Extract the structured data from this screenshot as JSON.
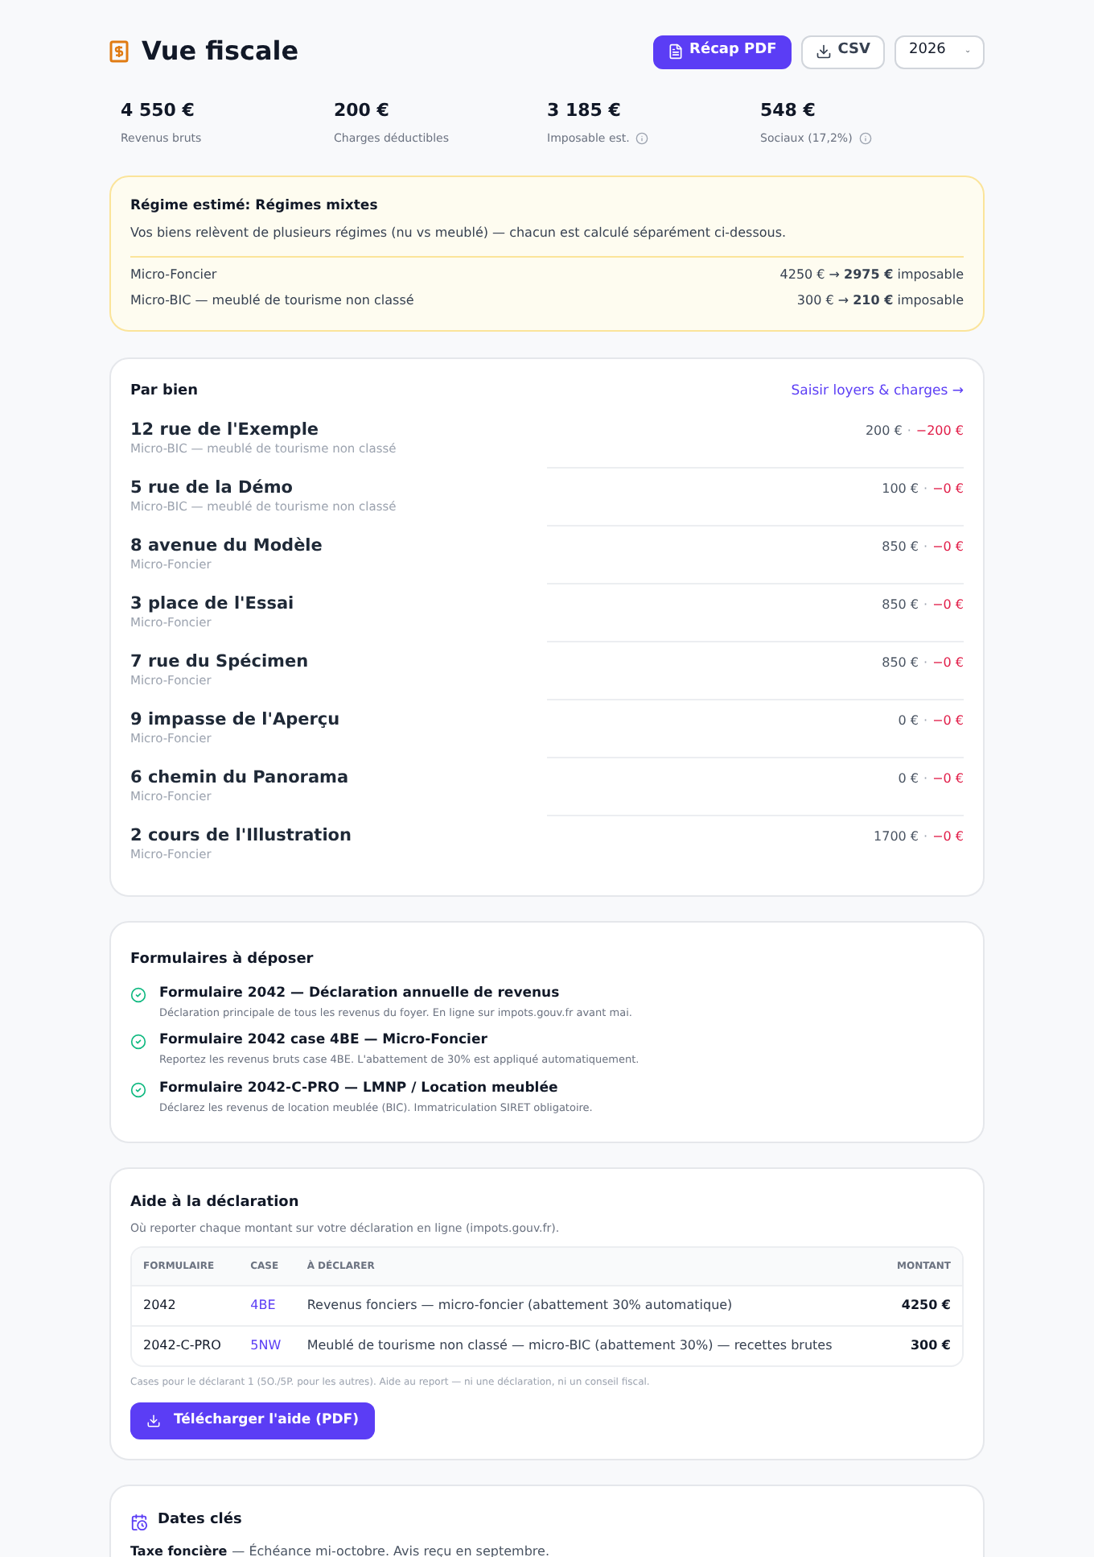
{
  "header": {
    "title": "Vue fiscale",
    "buttons": [
      {
        "label": "Récap PDF",
        "kind": "primary"
      },
      {
        "label": "CSV",
        "kind": "secondary"
      }
    ],
    "year": "2026"
  },
  "stats": [
    {
      "value": "4 550 €",
      "label": "Revenus bruts",
      "info": false
    },
    {
      "value": "200 €",
      "label": "Charges déductibles",
      "info": false
    },
    {
      "value": "3 185 €",
      "label": "Imposable est.",
      "info": true
    },
    {
      "value": "548 €",
      "label": "Sociaux (17,2%)",
      "info": true
    }
  ],
  "regime": {
    "title": "Régime estimé: Régimes mixtes",
    "description": "Vos biens relèvent de plusieurs régimes (nu vs meublé) — chacun est calculé séparément ci-dessous.",
    "lines": [
      {
        "name": "Micro-Foncier",
        "value": "4250 € → **2975 €** imposable"
      },
      {
        "name": "Micro-BIC — meublé de tourisme non classé",
        "value": "300 € → **210 €** imposable"
      }
    ]
  },
  "par_bien": {
    "title": "Par bien",
    "link": "Saisir loyers & charges →",
    "items": [
      {
        "address": "12 rue de l'Exemple",
        "regime": "Micro-BIC — meublé de tourisme non classé",
        "amount": "200 €",
        "separator": "·",
        "deduction": "−200 €"
      },
      {
        "address": "5 rue de la Démo",
        "regime": "Micro-BIC — meublé de tourisme non classé",
        "amount": "100 €",
        "separator": "·",
        "deduction": "−0 €"
      },
      {
        "address": "8 avenue du Modèle",
        "regime": "Micro-Foncier",
        "amount": "850 €",
        "separator": "·",
        "deduction": "−0 €"
      },
      {
        "address": "3 place de l'Essai",
        "regime": "Micro-Foncier",
        "amount": "850 €",
        "separator": "·",
        "deduction": "−0 €"
      },
      {
        "address": "7 rue du Spécimen",
        "regime": "Micro-Foncier",
        "amount": "850 €",
        "separator": "·",
        "deduction": "−0 €"
      },
      {
        "address": "9 impasse de l'Aperçu",
        "regime": "Micro-Foncier",
        "amount": "0 €",
        "separator": "·",
        "deduction": "−0 €"
      },
      {
        "address": "6 chemin du Panorama",
        "regime": "Micro-Foncier",
        "amount": "0 €",
        "separator": "·",
        "deduction": "−0 €"
      },
      {
        "address": "2 cours de l'Illustration",
        "regime": "Micro-Foncier",
        "amount": "1700 €",
        "separator": "·",
        "deduction": "−0 €"
      }
    ]
  },
  "formulaires": {
    "title": "Formulaires à déposer",
    "items": [
      {
        "title": "Formulaire 2042 — Déclaration annuelle de revenus",
        "description": "Déclaration principale de tous les revenus du foyer. En ligne sur impots.gouv.fr avant mai.",
        "checked": true
      },
      {
        "title": "Formulaire 2042 case 4BE — Micro-Foncier",
        "description": "Reportez les revenus bruts case 4BE. L'abattement de 30% est appliqué automatiquement.",
        "checked": true
      },
      {
        "title": "Formulaire 2042-C-PRO — LMNP / Location meublée",
        "description": "Déclarez les revenus de location meublée (BIC). Immatriculation SIRET obligatoire.",
        "checked": true
      }
    ]
  },
  "aide": {
    "title": "Aide à la déclaration",
    "subtitle": "Où reporter chaque montant sur votre déclaration en ligne (impots.gouv.fr).",
    "columns": [
      "FORMULAIRE",
      "CASE",
      "À DÉCLARER",
      "MONTANT"
    ],
    "rows": [
      {
        "formulaire": "2042",
        "case": "4BE",
        "description": "Revenus fonciers — micro-foncier (abattement 30% automatique)",
        "montant": "4250 €"
      },
      {
        "formulaire": "2042-C-PRO",
        "case": "5NW",
        "description": "Meublé de tourisme non classé — micro-BIC (abattement 30%) — recettes brutes",
        "montant": "300 €"
      }
    ],
    "note": "Cases pour le déclarant 1 (5O./5P. pour les autres). Aide au report — ni une déclaration, ni un conseil fiscal.",
    "button": "Télécharger l'aide (PDF)"
  },
  "dates": {
    "title": "Dates clés",
    "items": [
      {
        "name": "Taxe foncière",
        "text": "— Échéance mi-octobre. Avis reçu en septembre."
      }
    ]
  }
}
